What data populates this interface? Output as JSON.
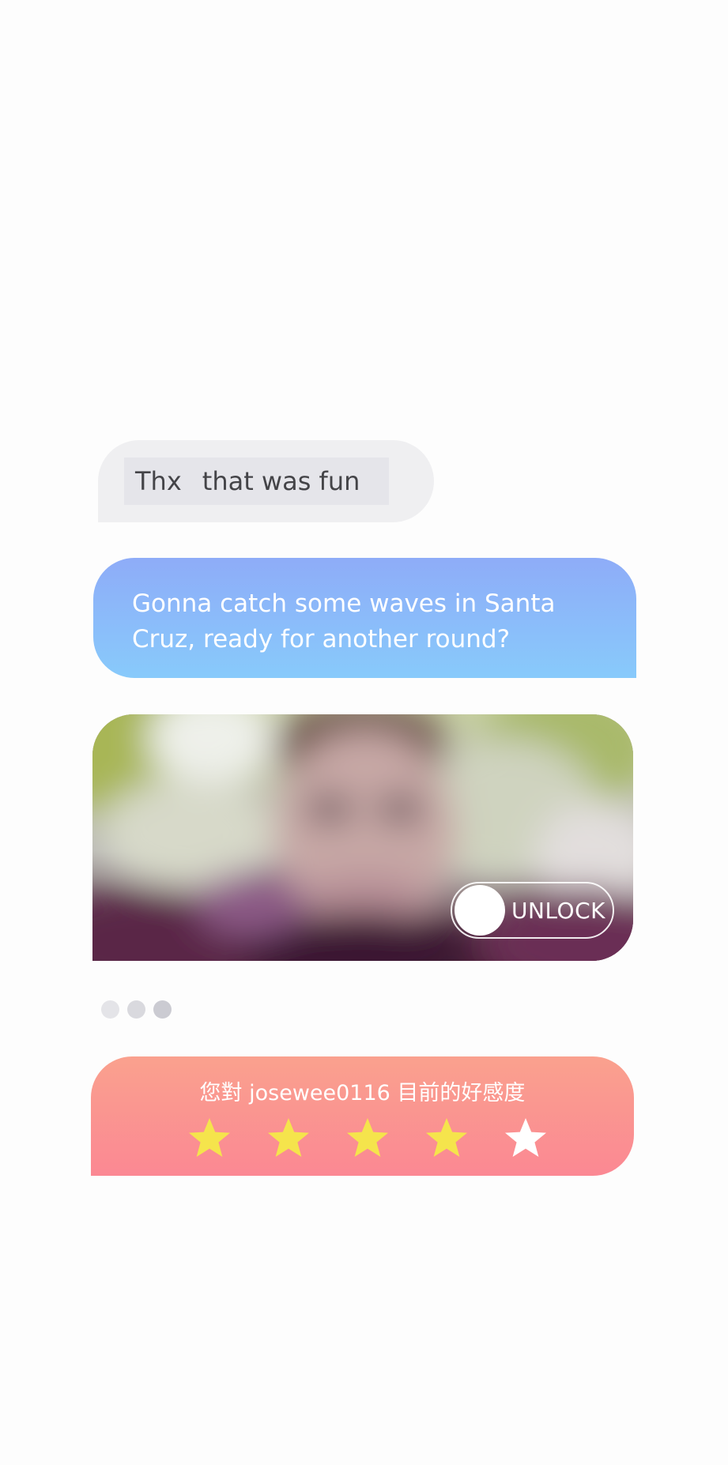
{
  "chat": {
    "incoming": {
      "words": [
        "Thx",
        "that was fun"
      ]
    },
    "outgoing": {
      "text": "Gonna catch some waves in Santa Cruz, ready for another round?"
    },
    "photo": {
      "unlock_label": "UNLOCK"
    },
    "typing_indicator": {
      "dot_colors": [
        "#e4e4e8",
        "#d9d9de",
        "#cbcbd2"
      ]
    },
    "rating": {
      "title": "您對 josewee0116 目前的好感度",
      "value": 4,
      "max": 5,
      "filled_color": "#f5e44c",
      "empty_color": "#ffffff"
    }
  },
  "colors": {
    "background": "#fdfdfd",
    "incoming_bubble": "#efeff1",
    "outgoing_gradient": [
      "#8eacf8",
      "#88cafb"
    ],
    "rating_gradient": [
      "#faa18e",
      "#fb8893"
    ]
  },
  "icons": {
    "star": "star-icon",
    "unlock_knob": "toggle-knob"
  }
}
